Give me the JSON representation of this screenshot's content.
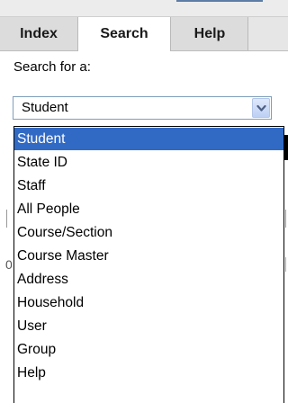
{
  "tabs": [
    {
      "label": "Index",
      "active": false
    },
    {
      "label": "Search",
      "active": true
    },
    {
      "label": "Help",
      "active": false
    }
  ],
  "search": {
    "label": "Search for a:",
    "selected_value": "Student"
  },
  "dropdown": {
    "options": [
      "Student",
      "State ID",
      "Staff",
      "All People",
      "Course/Section",
      "Course Master",
      "Address",
      "Household",
      "User",
      "Group",
      "Help"
    ],
    "highlighted_index": 0
  },
  "colors": {
    "highlight": "#316ac5",
    "tab_bar": "#dcdcdc",
    "select_border": "#7f9db9"
  },
  "background": {
    "left_glyph": "0"
  }
}
